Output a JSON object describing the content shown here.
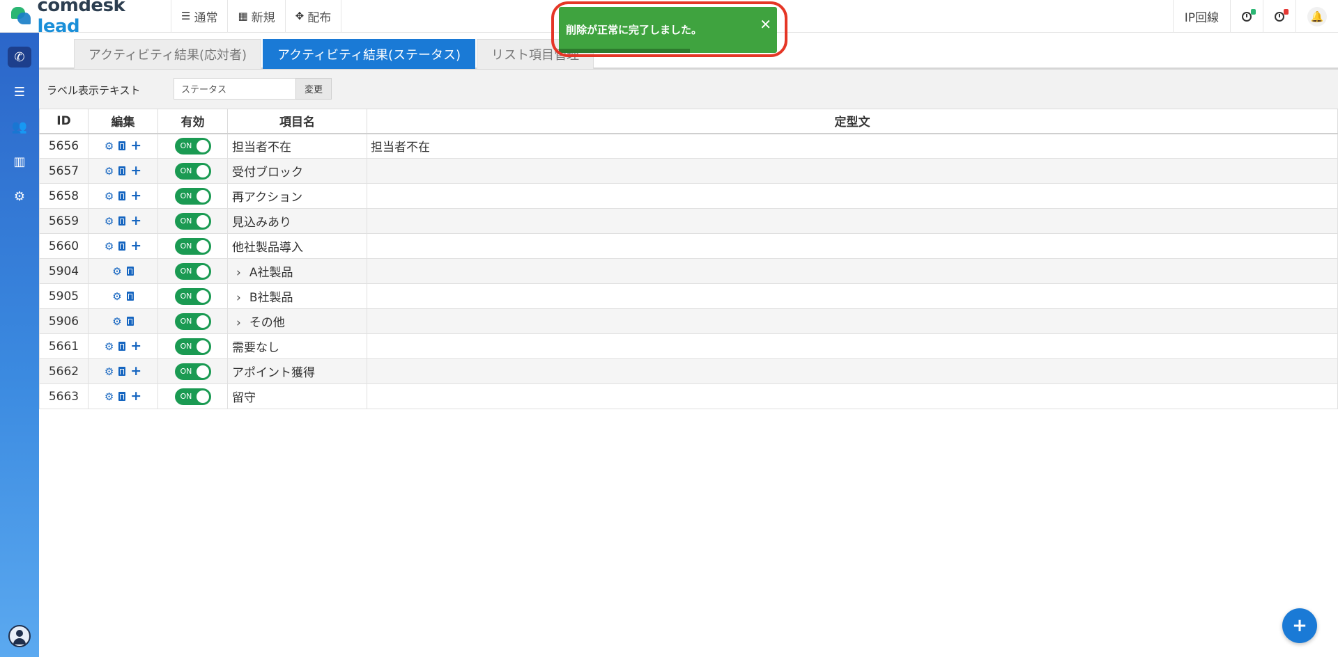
{
  "app": {
    "logo_main": "comdesk",
    "logo_accent": "lead"
  },
  "topnav": [
    {
      "label": "通常",
      "icon": "list-icon"
    },
    {
      "label": "新規",
      "icon": "grid-icon"
    },
    {
      "label": "配布",
      "icon": "expand-icon"
    }
  ],
  "topright": {
    "ip_label": "IP回線",
    "timer1_color": "#2bb673",
    "timer2_color": "#e53935"
  },
  "tabs": [
    "アクティビティ結果(応対者)",
    "アクティビティ結果(ステータス)",
    "リスト項目管理"
  ],
  "active_tab": 1,
  "labelbar": {
    "label": "ラベル表示テキスト",
    "value": "ステータス",
    "button": "変更"
  },
  "table": {
    "headers": [
      "ID",
      "編集",
      "有効",
      "項目名",
      "定型文"
    ],
    "rows": [
      {
        "id": "5656",
        "name": "担当者不在",
        "template": "担当者不在",
        "sub": false,
        "toggle": "ON"
      },
      {
        "id": "5657",
        "name": "受付ブロック",
        "template": "",
        "sub": false,
        "toggle": "ON"
      },
      {
        "id": "5658",
        "name": "再アクション",
        "template": "",
        "sub": false,
        "toggle": "ON"
      },
      {
        "id": "5659",
        "name": "見込みあり",
        "template": "",
        "sub": false,
        "toggle": "ON"
      },
      {
        "id": "5660",
        "name": "他社製品導入",
        "template": "",
        "sub": false,
        "toggle": "ON"
      },
      {
        "id": "5904",
        "name": "A社製品",
        "template": "",
        "sub": true,
        "toggle": "ON"
      },
      {
        "id": "5905",
        "name": "B社製品",
        "template": "",
        "sub": true,
        "toggle": "ON"
      },
      {
        "id": "5906",
        "name": "その他",
        "template": "",
        "sub": true,
        "toggle": "ON"
      },
      {
        "id": "5661",
        "name": "需要なし",
        "template": "",
        "sub": false,
        "toggle": "ON"
      },
      {
        "id": "5662",
        "name": "アポイント獲得",
        "template": "",
        "sub": false,
        "toggle": "ON"
      },
      {
        "id": "5663",
        "name": "留守",
        "template": "",
        "sub": false,
        "toggle": "ON"
      }
    ]
  },
  "toast": {
    "message": "削除が正常に完了しました。",
    "close": "✕",
    "progress": 0.6
  },
  "fab": {
    "label": "+"
  },
  "colors": {
    "primary": "#1a7ad6",
    "toggle_on": "#1a9a52",
    "toast_bg": "#3fa33f",
    "highlight": "#e53626"
  }
}
